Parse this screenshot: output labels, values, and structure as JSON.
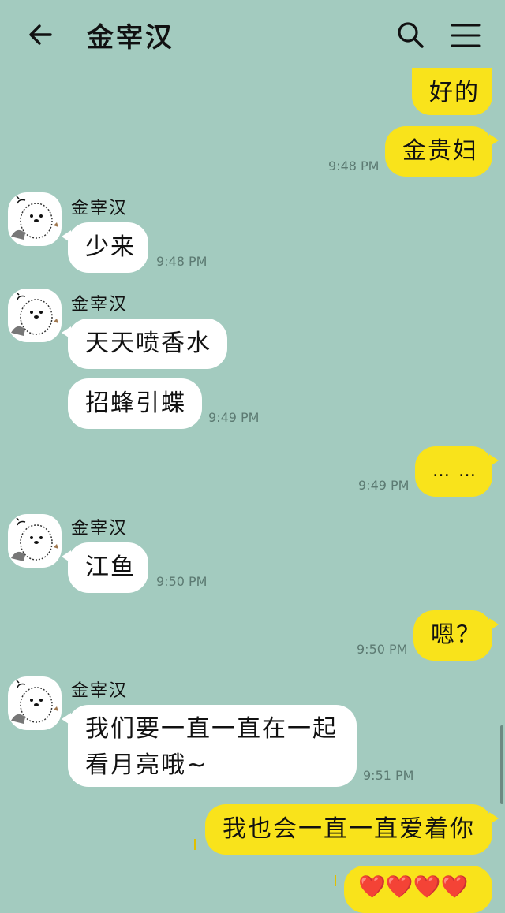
{
  "header": {
    "title": "金宰汉",
    "back_icon": "arrow-left-icon",
    "search_icon": "search-icon",
    "menu_icon": "hamburger-menu-icon"
  },
  "colors": {
    "background": "#a3cbbf",
    "incoming": "#ffffff",
    "outgoing": "#f9e31b"
  },
  "contact": {
    "name": "金宰汉",
    "avatar_icon": "bear-sticker-avatar"
  },
  "messages": [
    {
      "dir": "out",
      "text": "好的"
    },
    {
      "dir": "out",
      "text": "金贵妇",
      "time": "9:48 PM"
    },
    {
      "dir": "in",
      "text": "少来",
      "time": "9:48 PM"
    },
    {
      "dir": "in",
      "text": "天天喷香水"
    },
    {
      "dir": "in",
      "text": "招蜂引蝶",
      "time": "9:49 PM"
    },
    {
      "dir": "out",
      "text": "… …",
      "time": "9:49 PM"
    },
    {
      "dir": "in",
      "text": "江鱼",
      "time": "9:50 PM"
    },
    {
      "dir": "out",
      "text": "嗯？",
      "time": "9:50 PM"
    },
    {
      "dir": "in",
      "text_line1": "我们要一直一直在一起",
      "text_line2": "看月亮哦~",
      "time": "9:51 PM"
    },
    {
      "dir": "out",
      "text": "我也会一直一直爱着你"
    },
    {
      "dir": "out",
      "text": "❤️❤️❤️❤️"
    }
  ]
}
